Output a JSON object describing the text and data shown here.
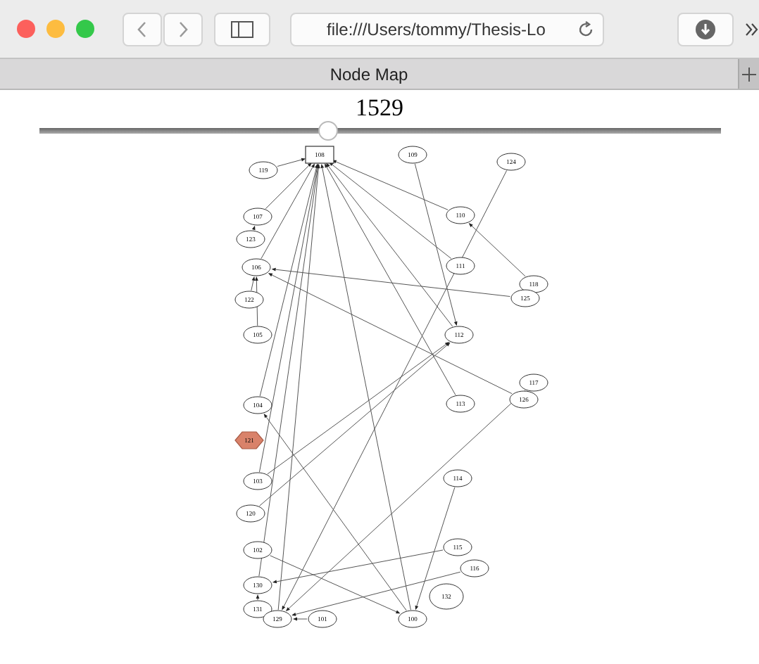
{
  "browser": {
    "address": "file:///Users/tommy/Thesis-Lo",
    "tab_title": "Node Map"
  },
  "page": {
    "title": "1529",
    "slider": {
      "level": 0.425
    }
  },
  "graph": {
    "nodes": [
      {
        "label": "108",
        "kind": "box"
      },
      {
        "label": "119",
        "kind": "ellipse"
      },
      {
        "label": "109",
        "kind": "ellipse"
      },
      {
        "label": "124",
        "kind": "ellipse"
      },
      {
        "label": "107",
        "kind": "ellipse"
      },
      {
        "label": "123",
        "kind": "ellipse"
      },
      {
        "label": "110",
        "kind": "ellipse"
      },
      {
        "label": "106",
        "kind": "ellipse"
      },
      {
        "label": "111",
        "kind": "ellipse"
      },
      {
        "label": "118",
        "kind": "ellipse"
      },
      {
        "label": "125",
        "kind": "ellipse"
      },
      {
        "label": "122",
        "kind": "ellipse"
      },
      {
        "label": "105",
        "kind": "ellipse"
      },
      {
        "label": "112",
        "kind": "ellipse"
      },
      {
        "label": "117",
        "kind": "ellipse"
      },
      {
        "label": "126",
        "kind": "ellipse"
      },
      {
        "label": "104",
        "kind": "ellipse"
      },
      {
        "label": "113",
        "kind": "ellipse"
      },
      {
        "label": "121",
        "kind": "hexagon"
      },
      {
        "label": "103",
        "kind": "ellipse"
      },
      {
        "label": "114",
        "kind": "ellipse"
      },
      {
        "label": "120",
        "kind": "ellipse"
      },
      {
        "label": "102",
        "kind": "ellipse"
      },
      {
        "label": "115",
        "kind": "ellipse"
      },
      {
        "label": "116",
        "kind": "ellipse"
      },
      {
        "label": "130",
        "kind": "ellipse"
      },
      {
        "label": "131",
        "kind": "ellipse"
      },
      {
        "label": "129",
        "kind": "ellipse"
      },
      {
        "label": "101",
        "kind": "ellipse"
      },
      {
        "label": "100",
        "kind": "ellipse"
      },
      {
        "label": "132",
        "kind": "ellipse"
      }
    ]
  }
}
